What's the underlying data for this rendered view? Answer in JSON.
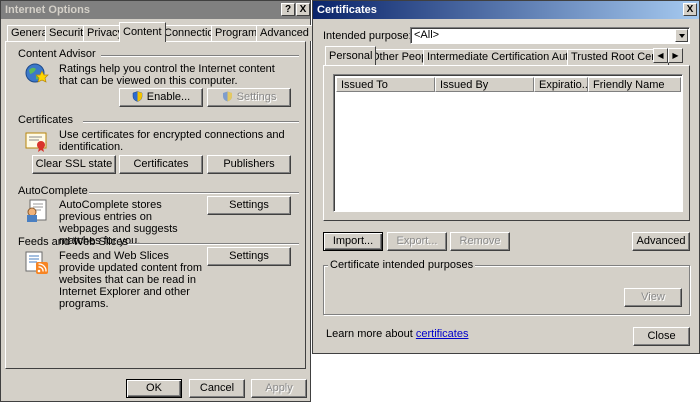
{
  "internet_options": {
    "title": "Internet Options",
    "help_btn": "?",
    "close_btn": "X",
    "tabs": [
      "General",
      "Security",
      "Privacy",
      "Content",
      "Connections",
      "Programs",
      "Advanced"
    ],
    "selected_tab": "Content",
    "content_advisor": {
      "heading": "Content Advisor",
      "description": "Ratings help you control the Internet content that can be viewed on this computer.",
      "enable_btn": "Enable...",
      "settings_btn": "Settings"
    },
    "certificates": {
      "heading": "Certificates",
      "description": "Use certificates for encrypted connections and identification.",
      "clear_ssl_btn": "Clear SSL state",
      "certificates_btn": "Certificates",
      "publishers_btn": "Publishers"
    },
    "autocomplete": {
      "heading": "AutoComplete",
      "description": "AutoComplete stores previous entries on webpages and suggests matches for you.",
      "settings_btn": "Settings"
    },
    "feeds": {
      "heading": "Feeds and Web Slices",
      "description": "Feeds and Web Slices provide updated content from websites that can be read in Internet Explorer and other programs.",
      "settings_btn": "Settings"
    },
    "ok_btn": "OK",
    "cancel_btn": "Cancel",
    "apply_btn": "Apply"
  },
  "certificates_dialog": {
    "title": "Certificates",
    "close_btn": "X",
    "intended_purpose_label": "Intended purpose:",
    "intended_purpose_value": "<All>",
    "tabs": [
      "Personal",
      "Other People",
      "Intermediate Certification Authorities",
      "Trusted Root Certification"
    ],
    "selected_tab": "Personal",
    "columns": [
      "Issued To",
      "Issued By",
      "Expiratio...",
      "Friendly Name"
    ],
    "import_btn": "Import...",
    "export_btn": "Export...",
    "remove_btn": "Remove",
    "advanced_btn": "Advanced",
    "purposes_group_label": "Certificate intended purposes",
    "view_btn": "View",
    "learn_more_text": "Learn more about ",
    "learn_more_link": "certificates",
    "close_dialog_btn": "Close"
  }
}
